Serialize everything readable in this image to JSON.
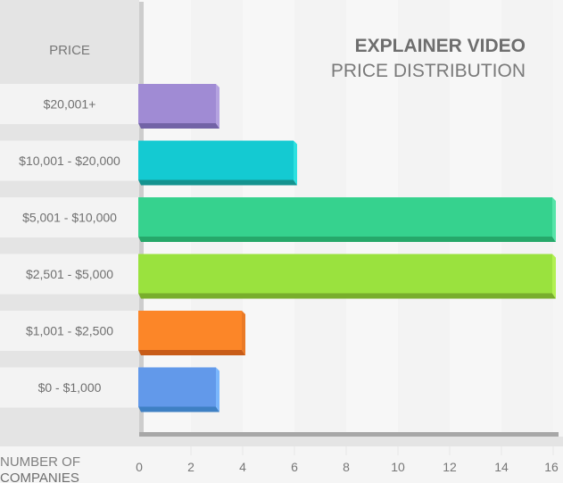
{
  "chart_data": {
    "type": "bar",
    "orientation": "horizontal",
    "title": "EXPLAINER VIDEO",
    "subtitle": "PRICE DISTRIBUTION",
    "category_header": "PRICE",
    "xlabel_line1": "NUMBER OF",
    "xlabel_line2": "COMPANIES",
    "ylabel": "PRICE",
    "xlim": [
      0,
      16
    ],
    "xticks": [
      0,
      2,
      4,
      6,
      8,
      10,
      12,
      14,
      16
    ],
    "grid": true,
    "categories": [
      "$20,001+",
      "$10,001 - $20,000",
      "$5,001 - $10,000",
      "$2,501 - $5,000",
      "$1,001 - $2,500",
      "$0 - $1,000"
    ],
    "values": [
      3,
      6,
      16,
      16,
      4,
      3
    ],
    "colors": [
      {
        "face": "#a08bd4",
        "bottom": "#7263a6",
        "side": "#b4a2e0"
      },
      {
        "face": "#14cad2",
        "bottom": "#14938f",
        "side": "#2ee0e0"
      },
      {
        "face": "#36d28e",
        "bottom": "#26a86a",
        "side": "#56e4a8"
      },
      {
        "face": "#9ae23e",
        "bottom": "#78ae2c",
        "side": "#b2f052"
      },
      {
        "face": "#fc8628",
        "bottom": "#c85c18",
        "side": "#ea7a26"
      },
      {
        "face": "#6299ea",
        "bottom": "#3e80c4",
        "side": "#7ab6fc"
      }
    ]
  }
}
